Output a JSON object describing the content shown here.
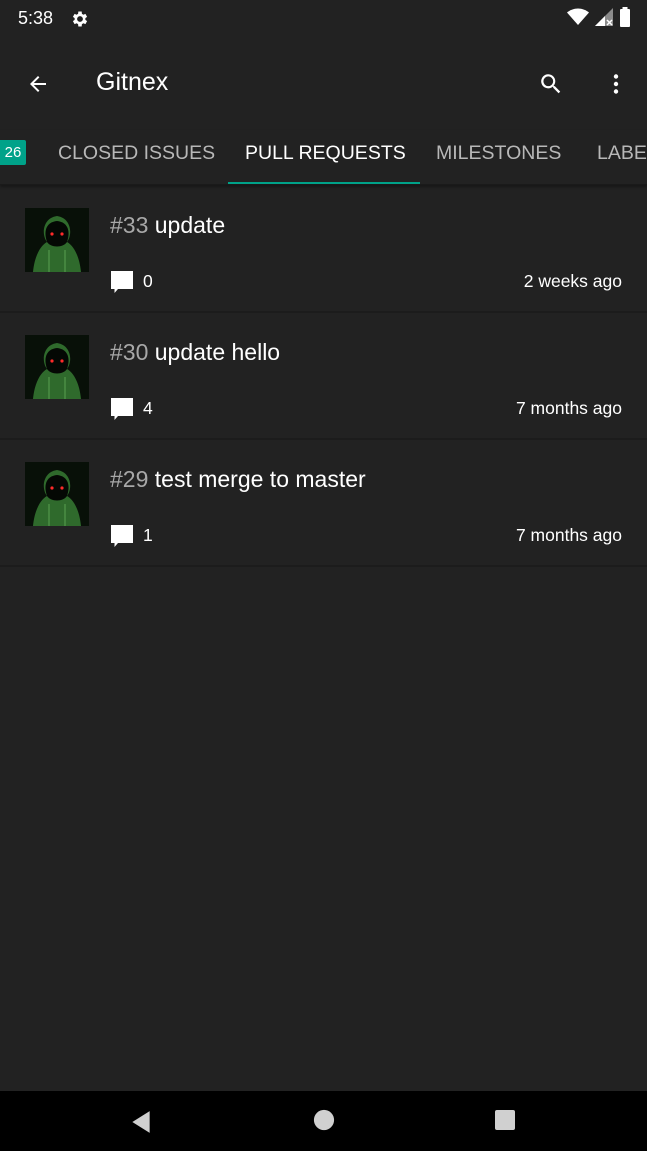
{
  "status_bar": {
    "time": "5:38",
    "icons": [
      "settings-gear-icon",
      "wifi-icon",
      "cellular-signal-icon",
      "battery-icon"
    ]
  },
  "app_bar": {
    "title": "Gitnex",
    "icons": [
      "arrow-back-icon",
      "search-icon",
      "more-vert-icon"
    ]
  },
  "tabs": {
    "badge": "26",
    "items": [
      {
        "label": "CLOSED ISSUES",
        "active": false
      },
      {
        "label": "PULL REQUESTS",
        "active": true
      },
      {
        "label": "MILESTONES",
        "active": false
      },
      {
        "label": "LABELS",
        "active": false
      }
    ]
  },
  "pull_requests": [
    {
      "number": "#33",
      "title": "update",
      "comments": "0",
      "time": "2 weeks ago"
    },
    {
      "number": "#30",
      "title": "update hello",
      "comments": "4",
      "time": "7 months ago"
    },
    {
      "number": "#29",
      "title": "test merge to master",
      "comments": "1",
      "time": "7 months ago"
    }
  ],
  "colors": {
    "background": "#222222",
    "accent": "#00a289",
    "text_primary": "#ffffff",
    "text_secondary": "#a8a8a8",
    "nav_bar": "#000000"
  },
  "nav_bar": {
    "icons": [
      "nav-back-icon",
      "nav-home-icon",
      "nav-recents-icon"
    ]
  }
}
